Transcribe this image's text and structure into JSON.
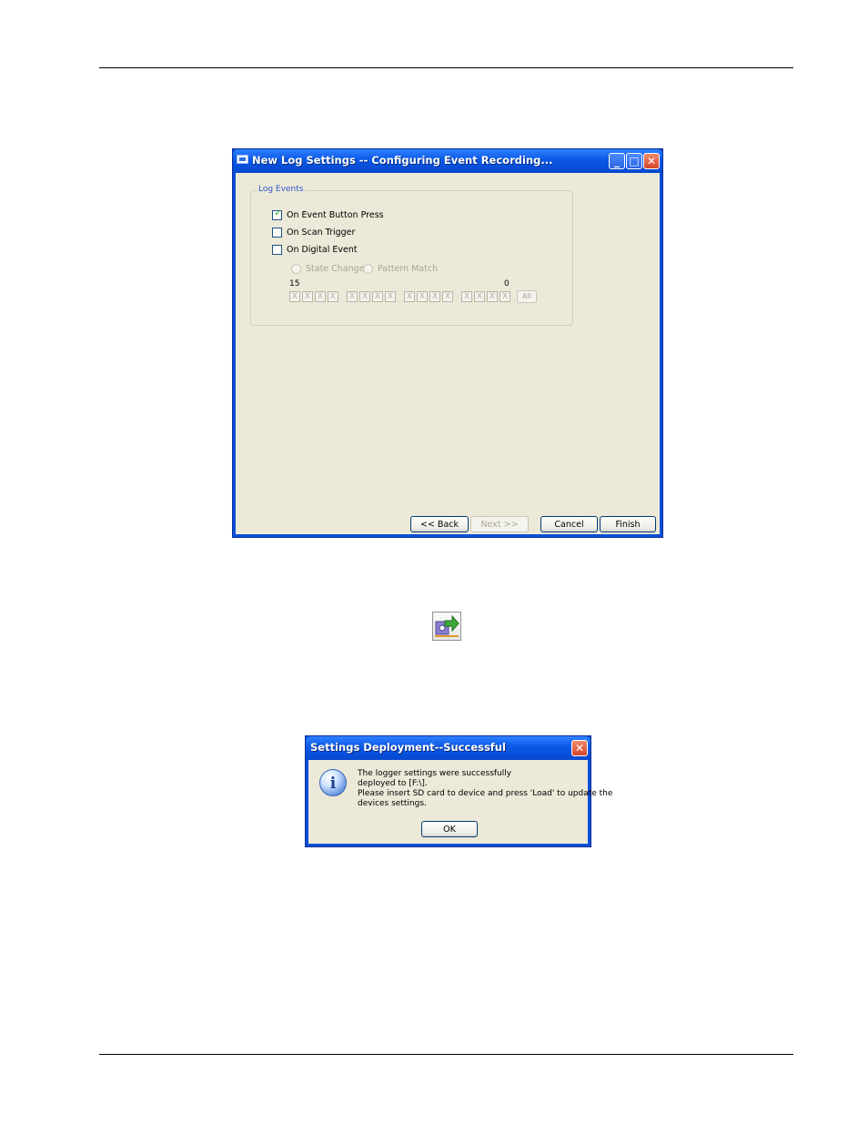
{
  "window1": {
    "title": "New Log Settings -- Configuring Event Recording...",
    "group_label": "Log Events",
    "checkboxes": [
      {
        "label": "On Event Button Press",
        "checked": true
      },
      {
        "label": "On Scan Trigger",
        "checked": false
      },
      {
        "label": "On Digital Event",
        "checked": false
      }
    ],
    "radios": [
      {
        "label": "State Change"
      },
      {
        "label": "Pattern Match"
      }
    ],
    "bit_high_label": "15",
    "bit_low_label": "0",
    "bit_value": "X",
    "all_button": "All",
    "buttons": {
      "back": "<< Back",
      "next": "Next >>",
      "cancel": "Cancel",
      "finish": "Finish"
    },
    "check_mark": "✓",
    "minimize_glyph": "_",
    "maximize_glyph": "□",
    "close_glyph": "✕"
  },
  "deploy_icon": {
    "name": "deploy-settings-icon"
  },
  "dialog": {
    "title": "Settings Deployment--Successful",
    "close_glyph": "✕",
    "icon_glyph": "i",
    "message_lines": [
      "The logger settings were successfully",
      "deployed to [F:\\].",
      "Please insert SD card to device and press 'Load' to update the",
      "devices settings."
    ],
    "ok_button": "OK"
  },
  "colors": {
    "xp_title_blue": "#0a58e6",
    "dialog_face": "#ece9d8",
    "group_label": "#2a56c8"
  }
}
